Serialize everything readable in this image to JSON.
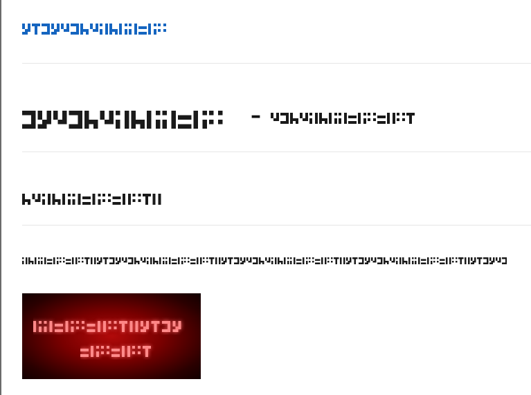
{
  "brand": {
    "text": "ᐃᓄᒃᑎᑐᑦ ᐅᖃᐅᓯᖅ",
    "color": "#1565c0"
  },
  "heading": {
    "main": "ᐃᓄᒃᑎᑐᑦ",
    "dash": "–",
    "secondary": "ᐃᓄᒃᑎᑐᑦ ᐅᖃᐅᓯᖅ"
  },
  "subheading": {
    "text": "ᐊᑐᐃᓐᓇᐅᔪᖅ ᐊᑐᕐᓂᖅ"
  },
  "paragraph": {
    "text": "ᐅᖃᐅᓯᖅ ᐅᔾᔨᕆᔭᐅᓂᖅ ᐊᑐᕐᓂᐊᖅᑐᖅ ᐅᓇ ᑲᒪᔪᖅ ᐃᓚᒋᔭᐅᔪᖅ ᐊᑐᐃᓐᓇᐅᔪᖅ ᑕ ᐃᓄᑦ ᐅᖃᐅᓯᖅ ᐃᓄᒃᑎᑐᑦ"
  },
  "banner": {
    "line1": "ᐅᖃᐅᓯᖅ ᐃᓄᒃᑎᑐᑦ ᐅᖃᐅᓯᖅ",
    "line2": "ᐅᖃᐅᓯᖅ.",
    "glow_color": "#ff4a4a",
    "background_color": "#7a0000"
  },
  "colors": {
    "text_dark": "#1a1a1a",
    "rule": "#e6e6e6"
  }
}
